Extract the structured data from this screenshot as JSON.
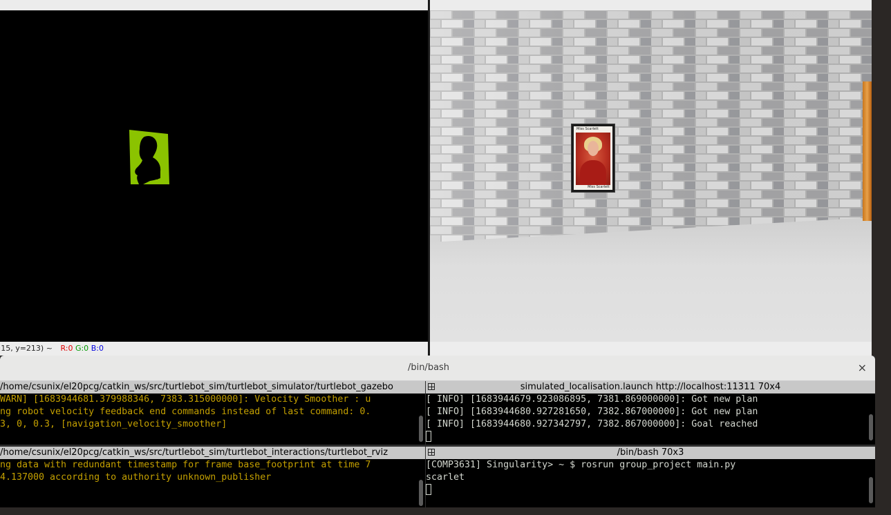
{
  "left_viewer": {
    "status": {
      "coords": "=15, y=213) ~ ",
      "r": "R:0",
      "g": "G:0",
      "b": "B:0"
    }
  },
  "right_viewer": {
    "portrait_caption_top": "Miss Scarlett",
    "portrait_caption_bottom": "Miss Scarlett"
  },
  "terminal": {
    "title": "/bin/bash",
    "close_glyph": "×",
    "panes": {
      "top_left": {
        "header": "/home/csunix/el20pcg/catkin_ws/src/turtlebot_sim/turtlebot_simulator/turtlebot_gazebo",
        "lines": [
          "WARN] [1683944681.379988346, 7383.315000000]: Velocity Smoother : u",
          "ng robot velocity feedback end commands instead of last command: 0.",
          "3, 0, 0.3, [navigation_velocity_smoother]"
        ]
      },
      "top_right": {
        "header": "simulated_localisation.launch http://localhost:11311 70x4",
        "lines": [
          "[ INFO] [1683944679.923086895, 7381.869000000]: Got new plan",
          "[ INFO] [1683944680.927281650, 7382.867000000]: Got new plan",
          "[ INFO] [1683944680.927342797, 7382.867000000]: Goal reached"
        ]
      },
      "bottom_left": {
        "header": "/home/csunix/el20pcg/catkin_ws/src/turtlebot_sim/turtlebot_interactions/turtlebot_rviz",
        "lines": [
          "ng data with redundant timestamp for frame base_footprint at time 7",
          "4.137000 according to authority unknown_publisher"
        ]
      },
      "bottom_right": {
        "header": "/bin/bash 70x3",
        "lines": [
          "[COMP3631] Singularity> ~ $ rosrun group_project main.py",
          "scarlet"
        ]
      }
    }
  },
  "colors": {
    "terminal_warn_text": "#c4a000",
    "terminal_info_text": "#d3d7cf",
    "mask_green": "#8bc300",
    "pane_header_bg": "#c8c8c8"
  },
  "icons": [
    "pane-grip-icon",
    "close-icon"
  ]
}
